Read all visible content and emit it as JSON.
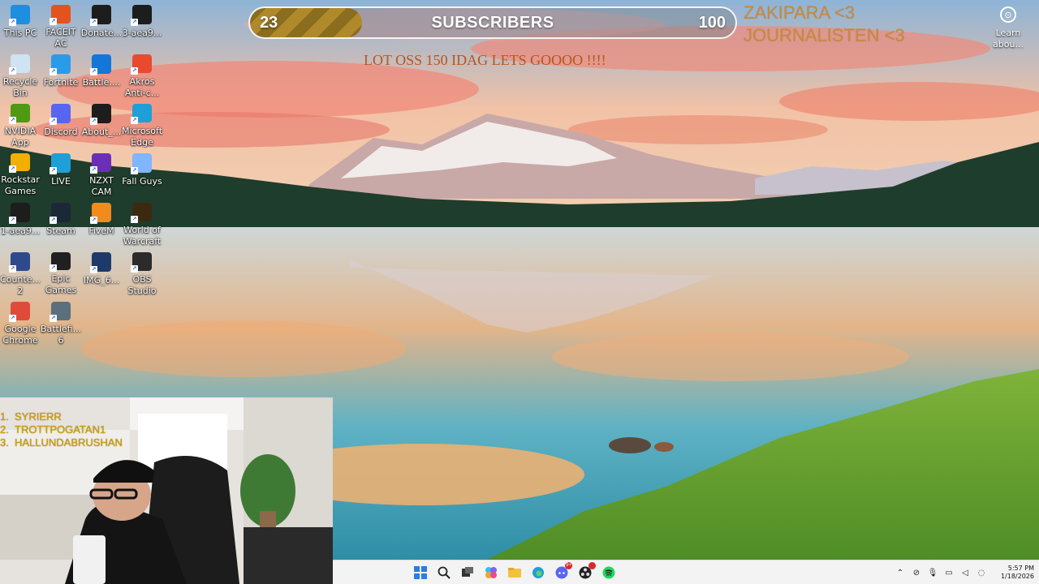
{
  "desktop": {
    "icons": [
      {
        "label": "This PC",
        "icon": "this-pc-icon",
        "color": "#1c8fe0"
      },
      {
        "label": "FACEIT AC",
        "icon": "faceit-icon",
        "color": "#e2531d"
      },
      {
        "label": "Donate...",
        "icon": "donate-shortcut-icon",
        "color": "#1d1d1d"
      },
      {
        "label": "3-aea9...",
        "icon": "file-thumbnail-icon",
        "color": "#1d1d1d"
      },
      {
        "label": "Recycle Bin",
        "icon": "recycle-bin-icon",
        "color": "#cfe3f2"
      },
      {
        "label": "Fortnite",
        "icon": "fortnite-icon",
        "color": "#2a9be8"
      },
      {
        "label": "Battle....",
        "icon": "battlenet-icon",
        "color": "#1476d6"
      },
      {
        "label": "Akros Anti-c...",
        "icon": "akros-icon",
        "color": "#e84a2f"
      },
      {
        "label": "NVIDIA App",
        "icon": "nvidia-icon",
        "color": "#4f9a12"
      },
      {
        "label": "Discord",
        "icon": "discord-icon",
        "color": "#5865f2"
      },
      {
        "label": "About_...",
        "icon": "file-thumbnail-icon",
        "color": "#1d1d1d"
      },
      {
        "label": "Microsoft Edge",
        "icon": "edge-icon",
        "color": "#1f9fd8"
      },
      {
        "label": "Rockstar Games ...",
        "icon": "rockstar-icon",
        "color": "#f1b000"
      },
      {
        "label": "LIVE",
        "icon": "edge-icon",
        "color": "#1f9fd8"
      },
      {
        "label": "NZXT CAM",
        "icon": "nzxt-cam-icon",
        "color": "#6b2fb7"
      },
      {
        "label": "Fall Guys",
        "icon": "fall-guys-icon",
        "color": "#7fb6ff"
      },
      {
        "label": "1-aea9...",
        "icon": "file-thumbnail-icon",
        "color": "#1d1d1d"
      },
      {
        "label": "Steam",
        "icon": "steam-icon",
        "color": "#1b2838"
      },
      {
        "label": "FiveM",
        "icon": "fivem-icon",
        "color": "#f28b1d"
      },
      {
        "label": "World of Warcraft",
        "icon": "wow-icon",
        "color": "#3b2a10"
      },
      {
        "label": "Counte... 2",
        "icon": "cs2-icon",
        "color": "#2f4a8a"
      },
      {
        "label": "Epic Games ...",
        "icon": "epic-games-icon",
        "color": "#202020"
      },
      {
        "label": "IMG_6...",
        "icon": "image-file-icon",
        "color": "#1e3a6a"
      },
      {
        "label": "OBS Studio",
        "icon": "obs-icon",
        "color": "#2b2b2b"
      },
      {
        "label": "Google Chrome",
        "icon": "chrome-icon",
        "color": "#de4b3a"
      },
      {
        "label": "Battlefi... 6",
        "icon": "battlefield-icon",
        "color": "#5b6f7c"
      }
    ],
    "right_icon": {
      "label": "Learn abou...",
      "icon": "learn-about-picture-icon"
    }
  },
  "overlay": {
    "subscriber_bar": {
      "current": "23",
      "title": "SUBSCRIBERS",
      "goal": "100",
      "progress_fraction": 0.23
    },
    "shoutout_lines": [
      "ZAKIPARA <3",
      "JOURNALISTEN <3"
    ],
    "ticker_text": "LOT OSS 150 IDAG LETS GOOOO !!!!",
    "top_list": [
      {
        "rank": "1.",
        "name": "SYRIERR"
      },
      {
        "rank": "2.",
        "name": "TROTTPOGATAN1"
      },
      {
        "rank": "3.",
        "name": "HALLUNDABRUSHAN"
      }
    ]
  },
  "taskbar": {
    "apps": [
      "windows-start-icon",
      "search-icon",
      "task-view-icon",
      "copilot-icon",
      "file-explorer-icon",
      "edge-icon",
      "discord-icon",
      "obs-icon",
      "spotify-icon"
    ],
    "discord_badge": "9+",
    "clock": {
      "time": "5:57 PM",
      "date": "1/18/2026"
    }
  },
  "colors": {
    "bar_fill": "#a07d27",
    "shoutout": "#c98a3a",
    "ticker": "#b9541d",
    "top_list": "#d1a400"
  }
}
